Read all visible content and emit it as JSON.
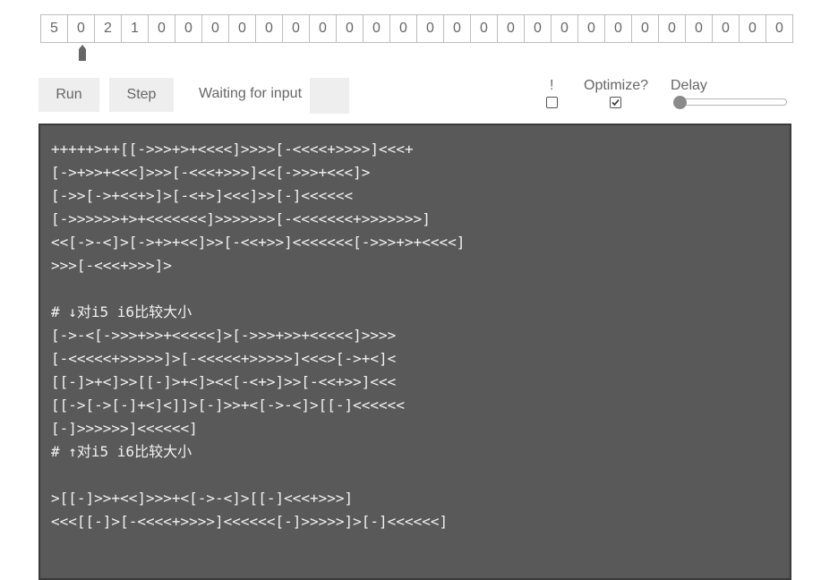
{
  "tape": {
    "cells": [
      "5",
      "0",
      "2",
      "1",
      "0",
      "0",
      "0",
      "0",
      "0",
      "0",
      "0",
      "0",
      "0",
      "0",
      "0",
      "0",
      "0",
      "0",
      "0",
      "0",
      "0",
      "0",
      "0",
      "0",
      "0",
      "0",
      "0",
      "0"
    ],
    "pointer_index": 1
  },
  "controls": {
    "run_label": "Run",
    "step_label": "Step",
    "status": "Waiting for input",
    "input_value": "",
    "exclaim_label": "!",
    "exclaim_checked": false,
    "optimize_label": "Optimize?",
    "optimize_checked": true,
    "delay_label": "Delay",
    "delay_value": 0
  },
  "editor": {
    "lines": [
      "+++++>++[[->>>+>+<<<<]>>>>[-<<<<+>>>>]<<<+",
      "[->+>>+<<<]>>>[-<<<+>>>]<<[->>>+<<<]>",
      "[->>[->+<<+>]>[-<+>]<<<]>>[-]<<<<<<",
      "[->>>>>>+>+<<<<<<<]>>>>>>>[-<<<<<<<+>>>>>>>]",
      "<<[->-<]>[->+>+<<]>>[-<<+>>]<<<<<<<[->>>+>+<<<<]",
      ">>>[-<<<+>>>]>",
      "",
      "# ↓对i5 i6比较大小",
      "[->-<[->>>+>>+<<<<<]>[->>>+>>+<<<<<]>>>>",
      "[-<<<<<+>>>>>]>[-<<<<<+>>>>>]<<<>[->+<]<",
      "[[-]>+<]>>[[-]>+<]><<[-<+>]>>[-<<+>>]<<<",
      "[[->[->[-]+<]<]]>[-]>>+<[->-<]>[[-]<<<<<<",
      "[-]>>>>>>]<<<<<<]",
      "# ↑对i5 i6比较大小",
      "",
      ">[[-]>>+<<]>>>+<[->-<]>[[-]<<<+>>>]",
      "<<<[[-]>[-<<<<+>>>>]<<<<<<[-]>>>>>]>[-]<<<<<<]"
    ]
  }
}
